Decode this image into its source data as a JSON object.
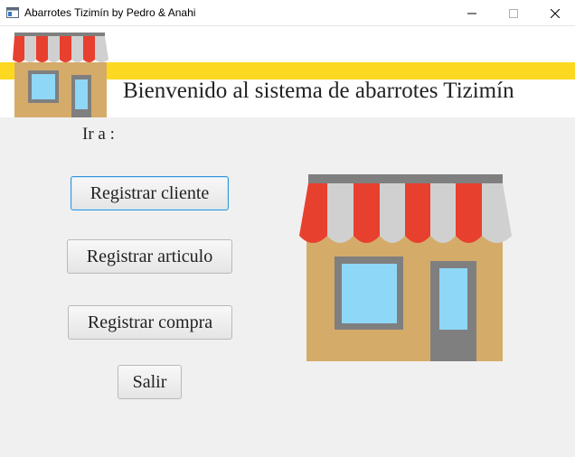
{
  "window": {
    "title": "Abarrotes Tizimín by Pedro & Anahi",
    "icon": "app-window-icon",
    "controls": [
      "minimize-icon",
      "maximize-icon",
      "close-icon"
    ]
  },
  "header": {
    "welcome_text": "Bienvenido al sistema de abarrotes Tizimín",
    "stripe_color": "#fcd820",
    "logo_icon": "storefront-icon"
  },
  "menu": {
    "prompt": "Ir a :",
    "buttons": [
      {
        "label": "Registrar cliente",
        "focused": true
      },
      {
        "label": "Registrar articulo",
        "focused": false
      },
      {
        "label": "Registrar compra",
        "focused": false
      },
      {
        "label": "Salir",
        "focused": false
      }
    ]
  },
  "illustration": {
    "icon": "storefront-icon",
    "colors": {
      "awning_red": "#e8402f",
      "awning_grey": "#d0d0d0",
      "wall": "#d5ab6a",
      "window": "#8ed7f7",
      "frame": "#7f7f7f"
    }
  }
}
